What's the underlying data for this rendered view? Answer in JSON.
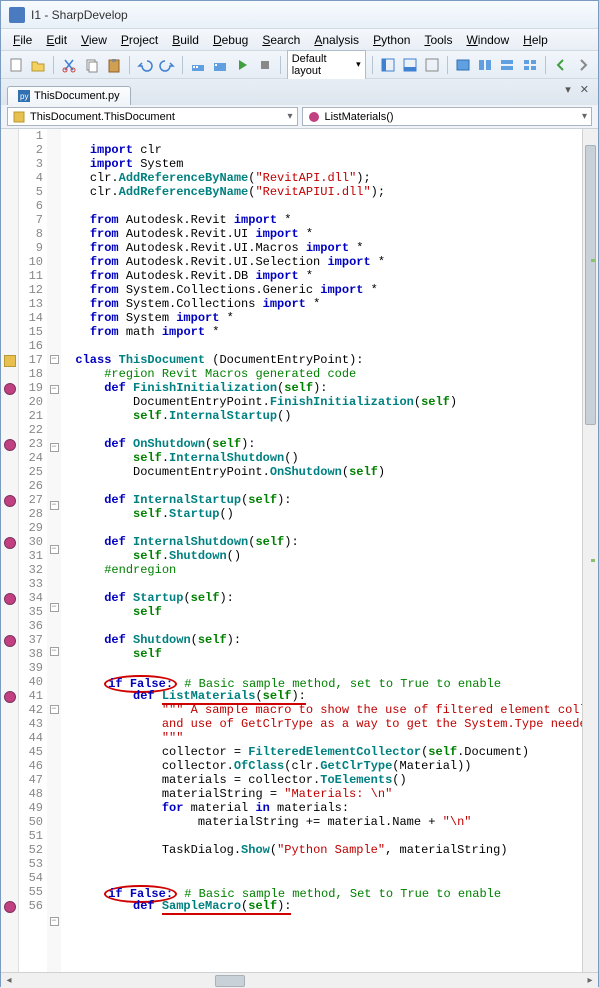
{
  "window": {
    "title": "I1 - SharpDevelop"
  },
  "menus": [
    "File",
    "Edit",
    "View",
    "Project",
    "Build",
    "Debug",
    "Search",
    "Analysis",
    "Python",
    "Tools",
    "Window",
    "Help"
  ],
  "toolbar": {
    "layout_label": "Default layout"
  },
  "tabs": {
    "active": "ThisDocument.py"
  },
  "dropdowns": {
    "left": "ThisDocument.ThisDocument",
    "right": "ListMaterials()"
  },
  "code": {
    "lines": [
      {
        "n": 1,
        "t": ""
      },
      {
        "n": 2,
        "t": "    ",
        "tokens": [
          [
            "kw",
            "import"
          ],
          [
            "",
            " clr"
          ]
        ]
      },
      {
        "n": 3,
        "t": "    ",
        "tokens": [
          [
            "kw",
            "import"
          ],
          [
            "",
            " System"
          ]
        ]
      },
      {
        "n": 4,
        "t": "    ",
        "tokens": [
          [
            "",
            "clr."
          ],
          [
            "cls",
            "AddReferenceByName"
          ],
          [
            "",
            "("
          ],
          [
            "str",
            "\"RevitAPI.dll\""
          ],
          [
            "",
            ");"
          ]
        ]
      },
      {
        "n": 5,
        "t": "    ",
        "tokens": [
          [
            "",
            "clr."
          ],
          [
            "cls",
            "AddReferenceByName"
          ],
          [
            "",
            "("
          ],
          [
            "str",
            "\"RevitAPIUI.dll\""
          ],
          [
            "",
            ");"
          ]
        ]
      },
      {
        "n": 6,
        "t": ""
      },
      {
        "n": 7,
        "t": "    ",
        "tokens": [
          [
            "kw",
            "from"
          ],
          [
            "",
            " Autodesk.Revit "
          ],
          [
            "kw",
            "import"
          ],
          [
            "",
            " *"
          ]
        ]
      },
      {
        "n": 8,
        "t": "    ",
        "tokens": [
          [
            "kw",
            "from"
          ],
          [
            "",
            " Autodesk.Revit.UI "
          ],
          [
            "kw",
            "import"
          ],
          [
            "",
            " *"
          ]
        ]
      },
      {
        "n": 9,
        "t": "    ",
        "tokens": [
          [
            "kw",
            "from"
          ],
          [
            "",
            " Autodesk.Revit.UI.Macros "
          ],
          [
            "kw",
            "import"
          ],
          [
            "",
            " *"
          ]
        ]
      },
      {
        "n": 10,
        "t": "    ",
        "tokens": [
          [
            "kw",
            "from"
          ],
          [
            "",
            " Autodesk.Revit.UI.Selection "
          ],
          [
            "kw",
            "import"
          ],
          [
            "",
            " *"
          ]
        ]
      },
      {
        "n": 11,
        "t": "    ",
        "tokens": [
          [
            "kw",
            "from"
          ],
          [
            "",
            " Autodesk.Revit.DB "
          ],
          [
            "kw",
            "import"
          ],
          [
            "",
            " *"
          ]
        ]
      },
      {
        "n": 12,
        "t": "    ",
        "tokens": [
          [
            "kw",
            "from"
          ],
          [
            "",
            " System.Collections.Generic "
          ],
          [
            "kw",
            "import"
          ],
          [
            "",
            " *"
          ]
        ]
      },
      {
        "n": 13,
        "t": "    ",
        "tokens": [
          [
            "kw",
            "from"
          ],
          [
            "",
            " System.Collections "
          ],
          [
            "kw",
            "import"
          ],
          [
            "",
            " *"
          ]
        ]
      },
      {
        "n": 14,
        "t": "    ",
        "tokens": [
          [
            "kw",
            "from"
          ],
          [
            "",
            " System "
          ],
          [
            "kw",
            "import"
          ],
          [
            "",
            " *"
          ]
        ]
      },
      {
        "n": 15,
        "t": "    ",
        "tokens": [
          [
            "kw",
            "from"
          ],
          [
            "",
            " math "
          ],
          [
            "kw",
            "import"
          ],
          [
            "",
            " *"
          ]
        ]
      },
      {
        "n": 16,
        "t": ""
      },
      {
        "n": 17,
        "t": "  ",
        "tokens": [
          [
            "kw",
            "class"
          ],
          [
            "",
            " "
          ],
          [
            "cls",
            "ThisDocument"
          ],
          [
            "",
            " (DocumentEntryPoint):"
          ]
        ],
        "marker": "class",
        "fold": "-"
      },
      {
        "n": 18,
        "t": "      ",
        "tokens": [
          [
            "com",
            "#region Revit Macros generated code"
          ]
        ]
      },
      {
        "n": 19,
        "t": "      ",
        "tokens": [
          [
            "kw",
            "def"
          ],
          [
            "",
            " "
          ],
          [
            "cls",
            "FinishInitialization"
          ],
          [
            "",
            "("
          ],
          [
            "kw2",
            "self"
          ],
          [
            "",
            "):"
          ]
        ],
        "marker": "dot",
        "fold": "-"
      },
      {
        "n": 20,
        "t": "          ",
        "tokens": [
          [
            "",
            "DocumentEntryPoint."
          ],
          [
            "cls",
            "FinishInitialization"
          ],
          [
            "",
            "("
          ],
          [
            "kw2",
            "self"
          ],
          [
            "",
            ")"
          ]
        ]
      },
      {
        "n": 21,
        "t": "          ",
        "tokens": [
          [
            "kw2",
            "self"
          ],
          [
            "",
            "."
          ],
          [
            "cls",
            "InternalStartup"
          ],
          [
            "",
            "()"
          ]
        ]
      },
      {
        "n": 22,
        "t": ""
      },
      {
        "n": 23,
        "t": "      ",
        "tokens": [
          [
            "kw",
            "def"
          ],
          [
            "",
            " "
          ],
          [
            "cls",
            "OnShutdown"
          ],
          [
            "",
            "("
          ],
          [
            "kw2",
            "self"
          ],
          [
            "",
            "):"
          ]
        ],
        "marker": "dot",
        "fold": "-"
      },
      {
        "n": 24,
        "t": "          ",
        "tokens": [
          [
            "kw2",
            "self"
          ],
          [
            "",
            "."
          ],
          [
            "cls",
            "InternalShutdown"
          ],
          [
            "",
            "()"
          ]
        ]
      },
      {
        "n": 25,
        "t": "          ",
        "tokens": [
          [
            "",
            "DocumentEntryPoint."
          ],
          [
            "cls",
            "OnShutdown"
          ],
          [
            "",
            "("
          ],
          [
            "kw2",
            "self"
          ],
          [
            "",
            ")"
          ]
        ]
      },
      {
        "n": 26,
        "t": ""
      },
      {
        "n": 27,
        "t": "      ",
        "tokens": [
          [
            "kw",
            "def"
          ],
          [
            "",
            " "
          ],
          [
            "cls",
            "InternalStartup"
          ],
          [
            "",
            "("
          ],
          [
            "kw2",
            "self"
          ],
          [
            "",
            "):"
          ]
        ],
        "marker": "dot",
        "fold": "-"
      },
      {
        "n": 28,
        "t": "          ",
        "tokens": [
          [
            "kw2",
            "self"
          ],
          [
            "",
            "."
          ],
          [
            "cls",
            "Startup"
          ],
          [
            "",
            "()"
          ]
        ]
      },
      {
        "n": 29,
        "t": ""
      },
      {
        "n": 30,
        "t": "      ",
        "tokens": [
          [
            "kw",
            "def"
          ],
          [
            "",
            " "
          ],
          [
            "cls",
            "InternalShutdown"
          ],
          [
            "",
            "("
          ],
          [
            "kw2",
            "self"
          ],
          [
            "",
            "):"
          ]
        ],
        "marker": "dot",
        "fold": "-"
      },
      {
        "n": 31,
        "t": "          ",
        "tokens": [
          [
            "kw2",
            "self"
          ],
          [
            "",
            "."
          ],
          [
            "cls",
            "Shutdown"
          ],
          [
            "",
            "()"
          ]
        ]
      },
      {
        "n": 32,
        "t": "      ",
        "tokens": [
          [
            "com",
            "#endregion"
          ]
        ]
      },
      {
        "n": 33,
        "t": ""
      },
      {
        "n": 34,
        "t": "      ",
        "tokens": [
          [
            "kw",
            "def"
          ],
          [
            "",
            " "
          ],
          [
            "cls",
            "Startup"
          ],
          [
            "",
            "("
          ],
          [
            "kw2",
            "self"
          ],
          [
            "",
            "):"
          ]
        ],
        "marker": "dot",
        "fold": "-"
      },
      {
        "n": 35,
        "t": "          ",
        "tokens": [
          [
            "kw2",
            "self"
          ]
        ]
      },
      {
        "n": 36,
        "t": ""
      },
      {
        "n": 37,
        "t": "      ",
        "tokens": [
          [
            "kw",
            "def"
          ],
          [
            "",
            " "
          ],
          [
            "cls",
            "Shutdown"
          ],
          [
            "",
            "("
          ],
          [
            "kw2",
            "self"
          ],
          [
            "",
            "):"
          ]
        ],
        "marker": "dot",
        "fold": "-"
      },
      {
        "n": 38,
        "t": "          ",
        "tokens": [
          [
            "kw2",
            "self"
          ]
        ]
      },
      {
        "n": 39,
        "t": ""
      },
      {
        "n": 40,
        "t": "      ",
        "tokens": [
          [
            "circle-kw",
            "if False:"
          ],
          [
            "",
            " "
          ],
          [
            "com",
            "# Basic sample method, set to True to enable"
          ]
        ]
      },
      {
        "n": 41,
        "t": "          ",
        "tokens": [
          [
            "kw",
            "def"
          ],
          [
            "",
            " "
          ],
          [
            "cls-ul",
            "ListMaterials"
          ],
          [
            "ul",
            "("
          ],
          [
            "kw2-ul",
            "self"
          ],
          [
            "ul",
            "):"
          ]
        ],
        "marker": "dot",
        "fold": "-"
      },
      {
        "n": 42,
        "t": "              ",
        "tokens": [
          [
            "str",
            "\"\"\" A sample macro to show the use of filtered element coll"
          ]
        ]
      },
      {
        "n": 43,
        "t": "              ",
        "tokens": [
          [
            "str",
            "and use of GetClrType as a way to get the System.Type neede"
          ]
        ]
      },
      {
        "n": 44,
        "t": "              ",
        "tokens": [
          [
            "str",
            "\"\"\""
          ]
        ]
      },
      {
        "n": 45,
        "t": "              ",
        "tokens": [
          [
            "",
            "collector = "
          ],
          [
            "cls",
            "FilteredElementCollector"
          ],
          [
            "",
            "("
          ],
          [
            "kw2",
            "self"
          ],
          [
            "",
            ".Document)"
          ]
        ]
      },
      {
        "n": 46,
        "t": "              ",
        "tokens": [
          [
            "",
            "collector."
          ],
          [
            "cls",
            "OfClass"
          ],
          [
            "",
            "(clr."
          ],
          [
            "cls",
            "GetClrType"
          ],
          [
            "",
            "(Material))"
          ]
        ]
      },
      {
        "n": 47,
        "t": "              ",
        "tokens": [
          [
            "",
            "materials = collector."
          ],
          [
            "cls",
            "ToElements"
          ],
          [
            "",
            "()"
          ]
        ]
      },
      {
        "n": 48,
        "t": "              ",
        "tokens": [
          [
            "",
            "materialString = "
          ],
          [
            "str",
            "\"Materials: \\n\""
          ]
        ]
      },
      {
        "n": 49,
        "t": "              ",
        "tokens": [
          [
            "kw",
            "for"
          ],
          [
            "",
            " material "
          ],
          [
            "kw",
            "in"
          ],
          [
            "",
            " materials:"
          ]
        ]
      },
      {
        "n": 50,
        "t": "                   ",
        "tokens": [
          [
            "",
            "materialString += material.Name + "
          ],
          [
            "str",
            "\"\\n\""
          ]
        ]
      },
      {
        "n": 51,
        "t": ""
      },
      {
        "n": 52,
        "t": "              ",
        "tokens": [
          [
            "",
            "TaskDialog."
          ],
          [
            "cls",
            "Show"
          ],
          [
            "",
            "("
          ],
          [
            "str",
            "\"Python Sample\""
          ],
          [
            "",
            ", materialString)"
          ]
        ]
      },
      {
        "n": 53,
        "t": ""
      },
      {
        "n": 54,
        "t": ""
      },
      {
        "n": 55,
        "t": "      ",
        "tokens": [
          [
            "circle-kw",
            "if False:"
          ],
          [
            "",
            " "
          ],
          [
            "com",
            "# Basic sample method, Set to True to enable"
          ]
        ]
      },
      {
        "n": 56,
        "t": "          ",
        "tokens": [
          [
            "kw",
            "def"
          ],
          [
            "",
            " "
          ],
          [
            "cls-ul",
            "SampleMacro"
          ],
          [
            "ul",
            "("
          ],
          [
            "kw2-ul",
            "self"
          ],
          [
            "ul",
            "):"
          ]
        ],
        "marker": "dot",
        "fold": "-"
      }
    ]
  }
}
